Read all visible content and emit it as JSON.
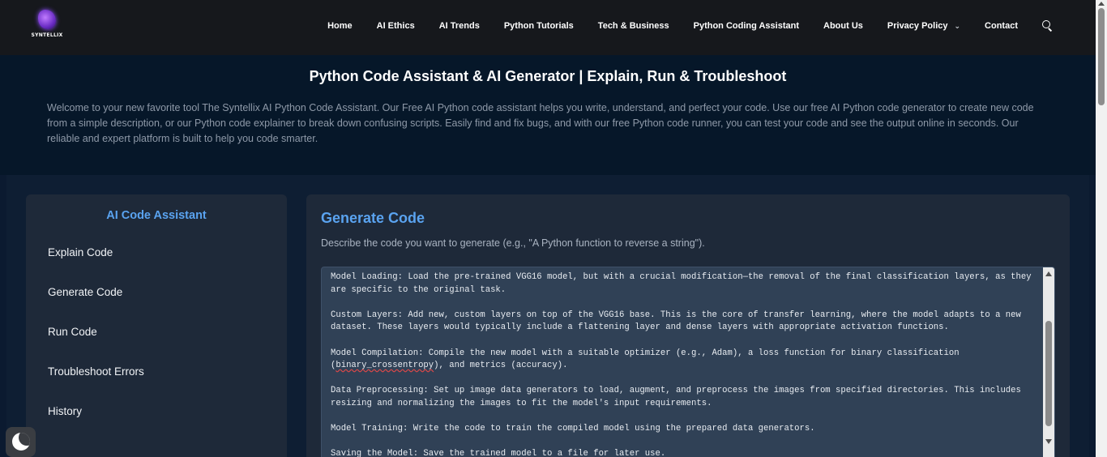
{
  "brand": {
    "name": "SYNTELLIX"
  },
  "nav": {
    "items": [
      {
        "label": "Home"
      },
      {
        "label": "AI Ethics"
      },
      {
        "label": "AI Trends"
      },
      {
        "label": "Python Tutorials"
      },
      {
        "label": "Tech & Business"
      },
      {
        "label": "Python Coding Assistant"
      },
      {
        "label": "About Us"
      },
      {
        "label": "Privacy Policy",
        "has_dropdown": true
      },
      {
        "label": "Contact"
      }
    ],
    "search_icon": "search-icon"
  },
  "hero": {
    "title": "Python Code Assistant & AI Generator | Explain, Run & Troubleshoot",
    "intro": "Welcome to your new favorite tool The Syntellix AI Python Code Assistant. Our Free AI Python code assistant helps you write, understand, and perfect your code. Use our free AI Python code generator to create new code from a simple description, or our Python code explainer to break down confusing scripts. Easily find and fix bugs, and with our free Python code runner, you can test your code and see the output online in seconds. Our reliable and expert platform is built to help you code smarter."
  },
  "sidebar": {
    "title": "AI Code Assistant",
    "items": [
      {
        "label": "Explain Code"
      },
      {
        "label": "Generate Code"
      },
      {
        "label": "Run Code"
      },
      {
        "label": "Troubleshoot Errors"
      },
      {
        "label": "History"
      }
    ]
  },
  "generate": {
    "heading": "Generate Code",
    "description": "Describe the code you want to generate (e.g., \"A Python function to reverse a string\").",
    "prompt": {
      "para1": "Model Loading: Load the pre-trained VGG16 model, but with a crucial modification—the removal of the final classification layers, as they are specific to the original task.",
      "para2": "Custom Layers: Add new, custom layers on top of the VGG16 base. This is the core of transfer learning, where the model adapts to a new dataset. These layers would typically include a flattening layer and dense layers with appropriate activation functions.",
      "para3_a": "Model Compilation: Compile the new model with a suitable optimizer (e.g., Adam), a loss function for binary classification (",
      "para3_b": "binary_crossentropy",
      "para3_c": "), and metrics (accuracy).",
      "para4": "Data Preprocessing: Set up image data generators to load, augment, and preprocess the images from specified directories. This includes resizing and normalizing the images to fit the model's input requirements.",
      "para5": "Model Training: Write the code to train the compiled model using the prepared data generators.",
      "para6": "Saving the Model: Save the trained model to a file for later use."
    }
  },
  "theme_toggle": {
    "icon": "moon-icon"
  },
  "colors": {
    "accent": "#5aa3f0",
    "header_bg": "#16181c",
    "page_bg": "#0b1a30",
    "panel_bg": "#1e2939",
    "textarea_bg": "#304156"
  }
}
